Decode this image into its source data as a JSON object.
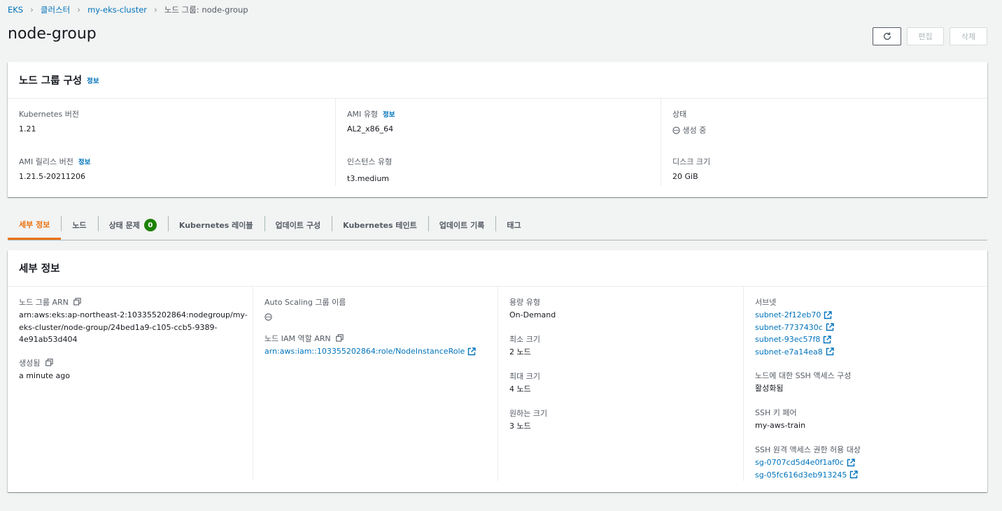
{
  "breadcrumb": {
    "items": [
      "EKS",
      "클러스터",
      "my-eks-cluster"
    ],
    "current": "노드 그룹: node-group"
  },
  "page": {
    "title": "node-group"
  },
  "actions": {
    "edit": "편집",
    "delete": "삭제"
  },
  "config": {
    "title": "노드 그룹 구성",
    "info": "정보",
    "k8s_version_label": "Kubernetes 버전",
    "k8s_version": "1.21",
    "ami_type_label": "AMI 유형",
    "ami_type": "AL2_x86_64",
    "status_label": "상태",
    "status": "생성 중",
    "ami_release_label": "AMI 릴리스 버전",
    "ami_release": "1.21.5-20211206",
    "instance_type_label": "인스턴스 유형",
    "instance_type": "t3.medium",
    "disk_label": "디스크 크기",
    "disk": "20 GiB"
  },
  "tabs": [
    {
      "label": "세부 정보",
      "active": true
    },
    {
      "label": "노드"
    },
    {
      "label": "상태 문제",
      "badge": "0"
    },
    {
      "label": "Kubernetes 레이블"
    },
    {
      "label": "업데이트 구성"
    },
    {
      "label": "Kubernetes 테인트"
    },
    {
      "label": "업데이트 기록"
    },
    {
      "label": "태그"
    }
  ],
  "details": {
    "title": "세부 정보",
    "arn_label": "노드 그룹 ARN",
    "arn_lines": [
      "arn:aws:eks:ap-northeast-2:103355202864:nodegroup/my-",
      "eks-cluster/node-group/24bed1a9-c105-ccb5-9389-",
      "4e91ab53d404"
    ],
    "created_label": "생성됨",
    "created": "a minute ago",
    "asg_label": "Auto Scaling 그룹 이름",
    "iam_label": "노드 IAM 역할 ARN",
    "iam_value": "arn:aws:iam::103355202864:role/NodeInstanceRole",
    "capacity_label": "용량 유형",
    "capacity": "On-Demand",
    "min_label": "최소 크기",
    "min": "2 노드",
    "max_label": "최대 크기",
    "max": "4 노드",
    "desired_label": "원하는 크기",
    "desired": "3 노드",
    "subnets_label": "서브넷",
    "subnets": [
      "subnet-2f12eb70",
      "subnet-7737430c",
      "subnet-93ec57f8",
      "subnet-e7a14ea8"
    ],
    "ssh_config_label": "노드에 대한 SSH 액세스 구성",
    "ssh_config": "활성화됨",
    "ssh_key_label": "SSH 키 페어",
    "ssh_key": "my-aws-train",
    "ssh_allow_label": "SSH 원격 액세스 권한 허용 대상",
    "security_groups": [
      "sg-0707cd5d4e0f1af0c",
      "sg-05fc616d3eb913245"
    ]
  }
}
